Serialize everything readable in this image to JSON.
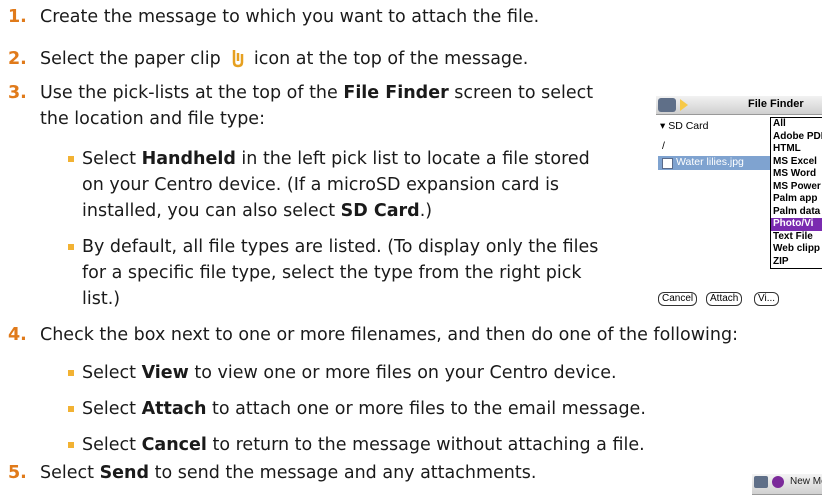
{
  "steps": {
    "s1": {
      "num": "1.",
      "text": "Create the message to which you want to attach the file."
    },
    "s2": {
      "num": "2.",
      "pre": "Select the paper clip",
      "post": "icon at the top of the message."
    },
    "s3": {
      "num": "3.",
      "line1_pre": "Use the pick-lists at the top of the ",
      "line1_bold": "File Finder",
      "line1_post": " screen to select",
      "line2": "the location and file type:",
      "b1": {
        "l1_pre": "Select ",
        "l1_bold": "Handheld",
        "l1_post": " in the left pick list to locate a file stored",
        "l2": "on your Centro device. (If a microSD expansion card is",
        "l3_pre": "installed, you can also select ",
        "l3_bold": "SD Card",
        "l3_post": ".)"
      },
      "b2": {
        "l1": "By default, all file types are listed. (To display only the files",
        "l2": "for a specific file type, select the type from the right pick",
        "l3": "list.)"
      }
    },
    "s4": {
      "num": "4.",
      "text": "Check the box next to one or more filenames, and then do one of the following:",
      "b1": {
        "pre": "Select ",
        "bold": "View",
        "post": " to view one or more files on your Centro device."
      },
      "b2": {
        "pre": "Select ",
        "bold": "Attach",
        "post": " to attach one or more files to the email message."
      },
      "b3": {
        "pre": "Select ",
        "bold": "Cancel",
        "post": " to return to the message without attaching a file."
      }
    },
    "s5": {
      "num": "5.",
      "pre": "Select ",
      "bold": "Send",
      "post": " to send the message and any attachments."
    }
  },
  "file_finder": {
    "title": "File Finder",
    "location": "SD Card",
    "path": "/",
    "file": "Water lilies.jpg",
    "types": [
      "All",
      "Adobe PDF",
      "HTML",
      "MS Excel",
      "MS Word",
      "MS Power",
      "Palm app",
      "Palm data",
      "Photo/Vi",
      "Text File",
      "Web clipp",
      "ZIP"
    ],
    "selected_type": "Photo/Vi",
    "cancel": "Cancel",
    "attach": "Attach",
    "view": "Vi..."
  },
  "new_message": {
    "title": "New Message"
  },
  "colors": {
    "step_number": "#e07a1a",
    "bullet": "#f2b233",
    "highlight": "#7a2bb0"
  }
}
